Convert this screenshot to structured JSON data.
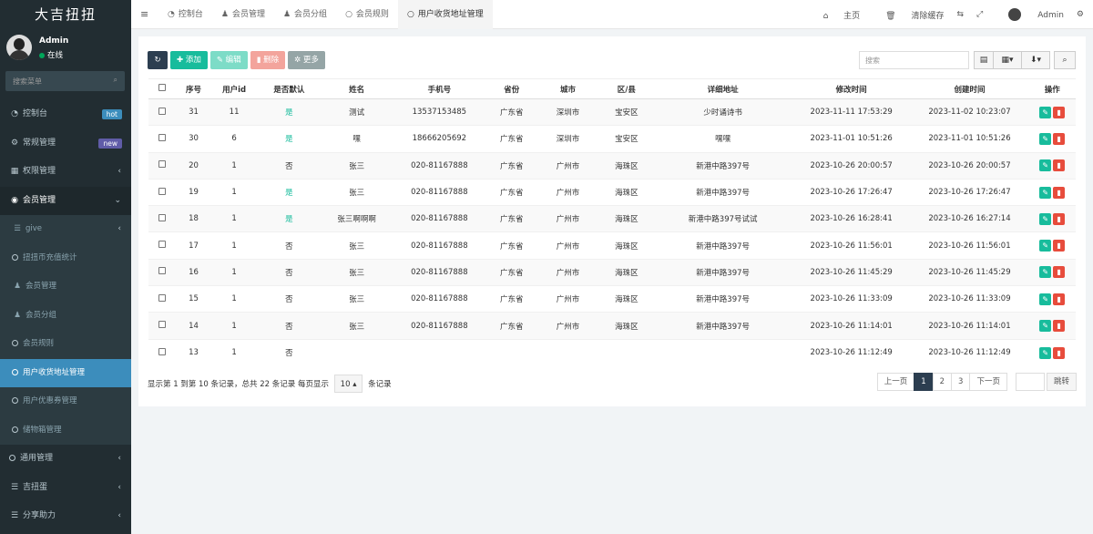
{
  "brand": "大吉扭扭",
  "user": {
    "name": "Admin",
    "status": "在线"
  },
  "sidebar_search_placeholder": "搜索菜单",
  "menu": [
    {
      "label": "控制台",
      "icon": "dashboard-icon",
      "badge": "hot"
    },
    {
      "label": "常规管理",
      "icon": "cogs-icon",
      "badge": "new"
    },
    {
      "label": "权限管理",
      "icon": "group-icon",
      "caret": "‹"
    },
    {
      "label": "会员管理",
      "icon": "user-circle-icon",
      "caret": "⌄"
    },
    {
      "label": "give",
      "icon": "list-icon",
      "caret": "‹"
    },
    {
      "label": "扭扭币充值统计",
      "icon": "circle-icon"
    },
    {
      "label": "会员管理",
      "icon": "user-icon"
    },
    {
      "label": "会员分组",
      "icon": "users-icon"
    },
    {
      "label": "会员规则",
      "icon": "circle-icon"
    },
    {
      "label": "用户收货地址管理",
      "icon": "circle-icon"
    },
    {
      "label": "用户优惠券管理",
      "icon": "circle-icon"
    },
    {
      "label": "储物箱管理",
      "icon": "circle-icon"
    },
    {
      "label": "通用管理",
      "icon": "circle-icon",
      "caret": "‹"
    },
    {
      "label": "吉扭蛋",
      "icon": "list-icon",
      "caret": "‹"
    },
    {
      "label": "分享助力",
      "icon": "list-icon",
      "caret": "‹"
    }
  ],
  "tabs": [
    {
      "label": "控制台",
      "icon": "dashboard-icon"
    },
    {
      "label": "会员管理",
      "icon": "user-icon"
    },
    {
      "label": "会员分组",
      "icon": "users-icon"
    },
    {
      "label": "会员规则",
      "icon": "circle-icon"
    },
    {
      "label": "用户收货地址管理",
      "icon": "circle-icon"
    }
  ],
  "topbar_right": {
    "home": "主页",
    "clear_cache": "清除缓存",
    "admin": "Admin"
  },
  "toolbar": {
    "add": "添加",
    "edit": "编辑",
    "delete": "删除",
    "more": "更多"
  },
  "table_search_placeholder": "搜索",
  "columns": [
    "序号",
    "用户id",
    "是否默认",
    "姓名",
    "手机号",
    "省份",
    "城市",
    "区/县",
    "详细地址",
    "修改时间",
    "创建时间",
    "操作"
  ],
  "rows": [
    [
      "31",
      "11",
      "是",
      "测试",
      "13537153485",
      "广东省",
      "深圳市",
      "宝安区",
      "少时诵诗书",
      "2023-11-11 17:53:29",
      "2023-11-02 10:23:07"
    ],
    [
      "30",
      "6",
      "是",
      "嘿",
      "18666205692",
      "广东省",
      "深圳市",
      "宝安区",
      "嘿嘿",
      "2023-11-01 10:51:26",
      "2023-11-01 10:51:26"
    ],
    [
      "20",
      "1",
      "否",
      "张三",
      "020-81167888",
      "广东省",
      "广州市",
      "海珠区",
      "新港中路397号",
      "2023-10-26 20:00:57",
      "2023-10-26 20:00:57"
    ],
    [
      "19",
      "1",
      "是",
      "张三",
      "020-81167888",
      "广东省",
      "广州市",
      "海珠区",
      "新港中路397号",
      "2023-10-26 17:26:47",
      "2023-10-26 17:26:47"
    ],
    [
      "18",
      "1",
      "是",
      "张三啊啊啊",
      "020-81167888",
      "广东省",
      "广州市",
      "海珠区",
      "新港中路397号试试",
      "2023-10-26 16:28:41",
      "2023-10-26 16:27:14"
    ],
    [
      "17",
      "1",
      "否",
      "张三",
      "020-81167888",
      "广东省",
      "广州市",
      "海珠区",
      "新港中路397号",
      "2023-10-26 11:56:01",
      "2023-10-26 11:56:01"
    ],
    [
      "16",
      "1",
      "否",
      "张三",
      "020-81167888",
      "广东省",
      "广州市",
      "海珠区",
      "新港中路397号",
      "2023-10-26 11:45:29",
      "2023-10-26 11:45:29"
    ],
    [
      "15",
      "1",
      "否",
      "张三",
      "020-81167888",
      "广东省",
      "广州市",
      "海珠区",
      "新港中路397号",
      "2023-10-26 11:33:09",
      "2023-10-26 11:33:09"
    ],
    [
      "14",
      "1",
      "否",
      "张三",
      "020-81167888",
      "广东省",
      "广州市",
      "海珠区",
      "新港中路397号",
      "2023-10-26 11:14:01",
      "2023-10-26 11:14:01"
    ],
    [
      "13",
      "1",
      "否",
      "",
      "",
      "",
      "",
      "",
      "",
      "2023-10-26 11:12:49",
      "2023-10-26 11:12:49"
    ]
  ],
  "footer": {
    "info_prefix": "显示第 1 到第 10 条记录，总共 22 条记录 每页显示",
    "per_page": "10",
    "info_suffix": "条记录"
  },
  "pagination": {
    "prev": "上一页",
    "pages": [
      "1",
      "2",
      "3"
    ],
    "current": "1",
    "next": "下一页",
    "jump": "跳转"
  },
  "colors": {
    "sidebar": "#222d32",
    "active": "#3c8dbc",
    "success": "#18bc9c",
    "danger": "#e74c3c"
  }
}
